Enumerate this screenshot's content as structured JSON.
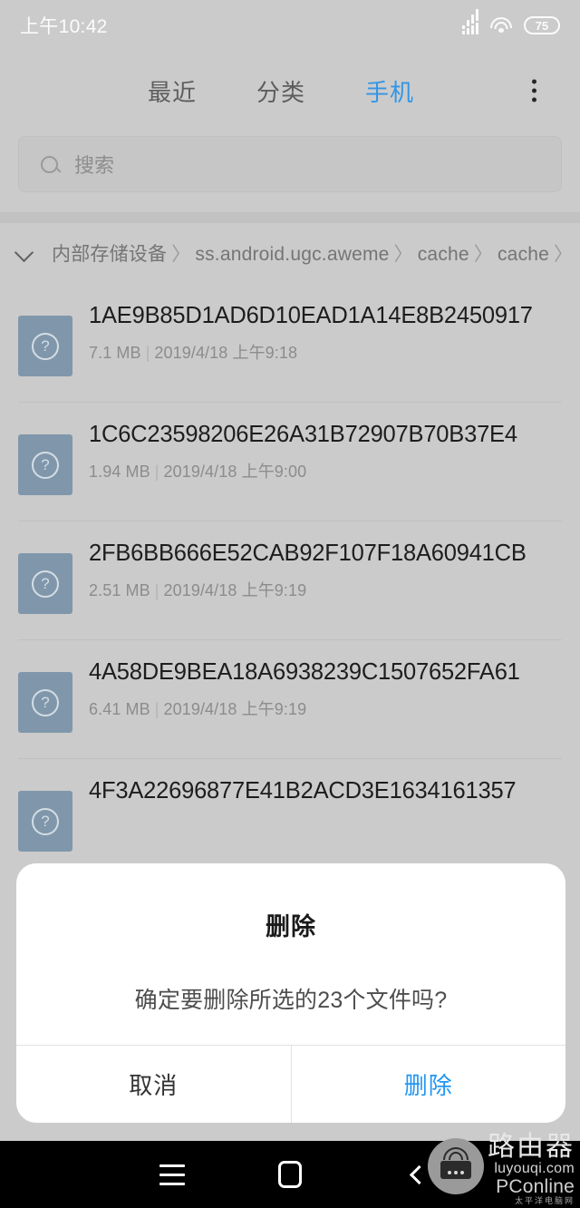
{
  "status_bar": {
    "time": "上午10:42",
    "battery_level": "75",
    "signal_icon": "cellular-signal-icon",
    "wifi_icon": "wifi-icon",
    "battery_icon": "battery-icon"
  },
  "tab_bar": {
    "tabs": [
      {
        "label": "最近",
        "active": false
      },
      {
        "label": "分类",
        "active": false
      },
      {
        "label": "手机",
        "active": true
      }
    ],
    "overflow_icon": "more-vertical-icon",
    "active_color": "#3296e6",
    "inactive_color": "#5d5d5d"
  },
  "search": {
    "placeholder": "搜索",
    "value": "",
    "icon": "search-icon"
  },
  "breadcrumb": {
    "expand_icon": "chevron-down-icon",
    "segments": [
      "内部存储设备",
      "ss.android.ugc.aweme",
      "cache",
      "cache"
    ],
    "separator": "〉",
    "trailing_separator": "〉"
  },
  "file_list": {
    "meta_separator": "|",
    "icon": "unknown-file-icon",
    "icon_glyph": "?",
    "files": [
      {
        "name": "1AE9B85D1AD6D10EAD1A14E8B2450917",
        "size": "7.1 MB",
        "date": "2019/4/18 上午9:18"
      },
      {
        "name": "1C6C23598206E26A31B72907B70B37E4",
        "size": "1.94 MB",
        "date": "2019/4/18 上午9:00"
      },
      {
        "name": "2FB6BB666E52CAB92F107F18A60941CB",
        "size": "2.51 MB",
        "date": "2019/4/18 上午9:19"
      },
      {
        "name": "4A58DE9BEA18A6938239C1507652FA61",
        "size": "6.41 MB",
        "date": "2019/4/18 上午9:19"
      },
      {
        "name": "4F3A22696877E41B2ACD3E1634161357",
        "size": "",
        "date": ""
      }
    ]
  },
  "dialog": {
    "title": "删除",
    "message": "确定要删除所选的23个文件吗?",
    "cancel_label": "取消",
    "confirm_label": "删除",
    "confirm_color": "#2196f3"
  },
  "nav_bar": {
    "menu_icon": "menu-icon",
    "home_icon": "home-icon",
    "back_icon": "back-icon"
  },
  "watermark": {
    "badge_icon": "router-icon",
    "brand_cn": "路由器",
    "url": "luyouqi.com",
    "pconline": "PConline",
    "pconline_cn": "太平洋电脑网"
  }
}
